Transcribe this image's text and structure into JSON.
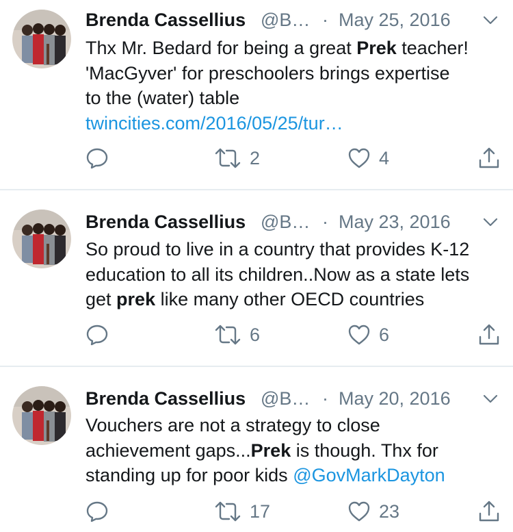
{
  "tweets": [
    {
      "name": "Brenda Cassellius",
      "handle": "@B…",
      "separator": "·",
      "date": "May 25, 2016",
      "text": {
        "l1a": "Thx Mr. Bedard for being a great ",
        "l1b": "Prek",
        "l1c": " teacher!",
        "l2": "'MacGyver' for preschoolers brings expertise",
        "l3": "to the (water) table",
        "link": "twincities.com/2016/05/25/tur…"
      },
      "retweets": "2",
      "likes": "4"
    },
    {
      "name": "Brenda Cassellius",
      "handle": "@B…",
      "separator": "·",
      "date": "May 23, 2016",
      "text": {
        "l1": "So proud to live in a country that provides K-12",
        "l2": "education to all its children..Now as a state lets",
        "l3a": "get ",
        "l3b": "prek",
        "l3c": " like many other OECD countries"
      },
      "retweets": "6",
      "likes": "6"
    },
    {
      "name": "Brenda Cassellius",
      "handle": "@B…",
      "separator": "·",
      "date": "May 20, 2016",
      "text": {
        "l1": "Vouchers are not a strategy to close",
        "l2a": "achievement gaps...",
        "l2b": "Prek",
        "l2c": " is though. Thx for",
        "l3a": "standing up for poor kids ",
        "l3b": "@GovMarkDayton"
      },
      "retweets": "17",
      "likes": "23"
    }
  ],
  "icons": {
    "reply": "reply-icon",
    "retweet": "retweet-icon",
    "like": "heart-icon",
    "share": "share-icon",
    "caret": "chevron-down-icon"
  },
  "colors": {
    "name": "#14171a",
    "muted": "#657786",
    "link": "#1b95e0",
    "divider": "#e6ecf0"
  }
}
